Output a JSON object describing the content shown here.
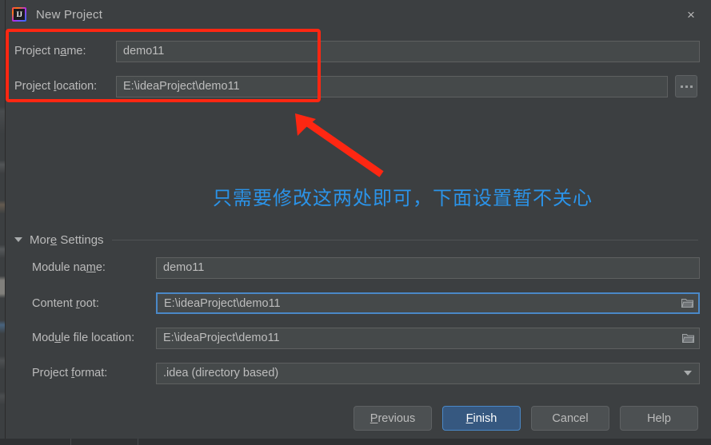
{
  "window": {
    "title": "New Project",
    "app_icon": "intellij-idea-icon",
    "icon_glyph": "IJ",
    "close_icon": "×"
  },
  "top_form": {
    "project_name": {
      "label_pre": "Project n",
      "label_mnemonic": "a",
      "label_post": "me:",
      "value": "demo11"
    },
    "project_location": {
      "label_pre": "Project ",
      "label_mnemonic": "l",
      "label_post": "ocation:",
      "value": "E:\\ideaProject\\demo11",
      "browse_button": "..."
    }
  },
  "more_settings": {
    "label_pre": "Mor",
    "label_mnemonic": "e",
    "label_post": " Settings",
    "expanded": true,
    "fields": [
      {
        "name": "module-name",
        "label_pre": "Module na",
        "label_mnemonic": "m",
        "label_post": "e:",
        "value": "demo11",
        "type": "text",
        "focused": false,
        "has_folder_icon": false
      },
      {
        "name": "content-root",
        "label_pre": "Content ",
        "label_mnemonic": "r",
        "label_post": "oot:",
        "value": "E:\\ideaProject\\demo11",
        "type": "text",
        "focused": true,
        "has_folder_icon": true
      },
      {
        "name": "module-file-location",
        "label_pre": "Mod",
        "label_mnemonic": "u",
        "label_post": "le file location:",
        "value": "E:\\ideaProject\\demo11",
        "type": "text",
        "focused": false,
        "has_folder_icon": true
      },
      {
        "name": "project-format",
        "label_pre": "Project ",
        "label_mnemonic": "f",
        "label_post": "ormat:",
        "value": ".idea (directory based)",
        "type": "combo",
        "focused": false,
        "has_folder_icon": false
      }
    ]
  },
  "buttons": [
    {
      "name": "previous",
      "pre": "",
      "mnemonic": "P",
      "post": "revious",
      "primary": false
    },
    {
      "name": "finish",
      "pre": "",
      "mnemonic": "F",
      "post": "inish",
      "primary": true
    },
    {
      "name": "cancel",
      "pre": "Cancel",
      "mnemonic": "",
      "post": "",
      "primary": false
    },
    {
      "name": "help",
      "pre": "Help",
      "mnemonic": "",
      "post": "",
      "primary": false
    }
  ],
  "annotations": {
    "highlight_rect_color": "#fe2712",
    "arrow_color": "#fe2712",
    "note_text": "只需要修改这两处即可，下面设置暂不关心",
    "note_color": "#2b93e8"
  },
  "colors": {
    "dialog_bg": "#3c3f41",
    "field_bg": "#45494a",
    "field_border": "#5e6060",
    "focus_border": "#4a88c7",
    "text": "#bbbbbb",
    "primary_button_bg": "#365880"
  }
}
